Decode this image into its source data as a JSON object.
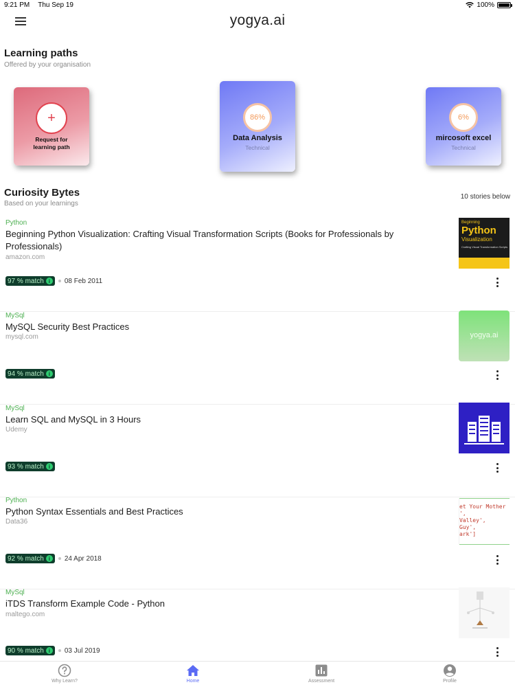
{
  "status": {
    "time": "9:21 PM",
    "date": "Thu Sep 19",
    "battery": "100%"
  },
  "header": {
    "brand": "yogya.ai"
  },
  "learning_paths": {
    "title": "Learning paths",
    "subtitle": "Offered by your organisation",
    "request_card": {
      "plus": "+",
      "label_line1": "Request for",
      "label_line2": "learning path"
    },
    "cards": [
      {
        "progress": "86%",
        "name": "Data Analysis",
        "type": "Technical"
      },
      {
        "progress": "6%",
        "name": "mircosoft excel",
        "type": "Technical"
      }
    ]
  },
  "curiosity": {
    "title": "Curiosity Bytes",
    "subtitle": "Based on your learnings",
    "count": "10 stories below",
    "stories": [
      {
        "tag": "Python",
        "title": "Beginning Python Visualization: Crafting Visual Transformation Scripts (Books for Professionals by Professionals)",
        "source": "amazon.com",
        "match": "97 % match",
        "date": "08 Feb 2011",
        "thumb": {
          "top": "Beginning",
          "main": "Python",
          "sub": "Visualization",
          "line": "Crafting Visual Transformation Scripts"
        }
      },
      {
        "tag": "MySql",
        "title": "MySQL Security Best Practices",
        "source": "mysql.com",
        "match": "94 % match",
        "date": "",
        "thumb": {
          "text": "yogya.ai"
        }
      },
      {
        "tag": "MySql",
        "title": "Learn SQL and MySQL in 3 Hours",
        "source": "Udemy",
        "match": "93 % match",
        "date": ""
      },
      {
        "tag": "Python",
        "title": "Python Syntax Essentials and Best Practices",
        "source": "Data36",
        "match": "92 % match",
        "date": "24 Apr 2018",
        "thumb": {
          "lines": [
            "et Your Mother",
            "',",
            " Valley',",
            " Guy',",
            "ark']"
          ]
        }
      },
      {
        "tag": "MySql",
        "title": "iTDS Transform Example Code - Python",
        "source": "maltego.com",
        "match": "90 % match",
        "date": "03 Jul 2019"
      }
    ]
  },
  "nav": {
    "items": [
      {
        "label": "Why Learn?",
        "icon": "question-icon"
      },
      {
        "label": "Home",
        "icon": "home-icon"
      },
      {
        "label": "Assessment",
        "icon": "chart-icon"
      },
      {
        "label": "Profile",
        "icon": "person-icon"
      }
    ]
  },
  "colors": {
    "accent": "#5b6bf4",
    "tag_green": "#4caf50",
    "match_badge": "#0f3d2c",
    "request_red": "#e2434f"
  }
}
